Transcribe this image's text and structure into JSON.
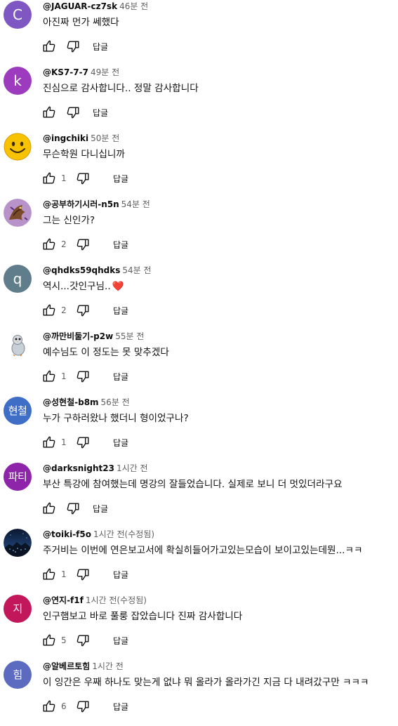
{
  "comments": [
    {
      "author": "@JAGUAR-cz7sk",
      "time": "46분 전",
      "text": "아진짜 먼가 쎄했다",
      "likes": "",
      "reply": "답글",
      "avatar": {
        "type": "letter",
        "letter": "C",
        "color": "#7e57c2"
      }
    },
    {
      "author": "@KS7-7-7",
      "time": "49분 전",
      "text": "진심으로 감사합니다.. 정말 감사합니다",
      "likes": "",
      "reply": "답글",
      "avatar": {
        "type": "letter",
        "letter": "k",
        "color": "#9c3bbd"
      }
    },
    {
      "author": "@ingchiki",
      "time": "50분 전",
      "text": "무슨학원 다니십니까",
      "likes": "1",
      "reply": "답글",
      "avatar": {
        "type": "icon",
        "icon": "smiley-face-icon"
      }
    },
    {
      "author": "@공부하기시러-n5n",
      "time": "54분 전",
      "text": "그는 신인가?",
      "likes": "2",
      "reply": "답글",
      "avatar": {
        "type": "icon",
        "icon": "dragon-illustration-icon"
      }
    },
    {
      "author": "@qhdks59qhdks",
      "time": "54분 전",
      "text": "역시...갓인구님..",
      "likes": "2",
      "reply": "답글",
      "heart": "❤️",
      "avatar": {
        "type": "letter",
        "letter": "q",
        "color": "#607d8b"
      }
    },
    {
      "author": "@까만비둘기-p2w",
      "time": "55분 전",
      "text": "예수님도 이 정도는 못 맞추겠다",
      "likes": "1",
      "reply": "답글",
      "avatar": {
        "type": "icon",
        "icon": "pigeon-icon"
      }
    },
    {
      "author": "@성현철-b8m",
      "time": "56분 전",
      "text": "누가 구하러왔나 했더니 형이었구나?",
      "likes": "1",
      "reply": "답글",
      "avatar": {
        "type": "letter",
        "letter": "현철",
        "color": "#3f6ec7"
      }
    },
    {
      "author": "@darksnight23",
      "time": "1시간 전",
      "text": "부산 특강에 참여했는데 명강의 잘들었습니다. 실제로 보니 더 멋있더라구요",
      "likes": "",
      "reply": "답글",
      "avatar": {
        "type": "letter",
        "letter": "파티",
        "color": "#8e24aa"
      }
    },
    {
      "author": "@toiki-f5o",
      "time": "1시간 전(수정됨)",
      "text": "주거비는 이번에 연은보고서에 확실히들어가고있는모습이 보이고있는데뭔...ㅋㅋ",
      "likes": "1",
      "reply": "답글",
      "avatar": {
        "type": "icon",
        "icon": "night-city-photo-icon"
      }
    },
    {
      "author": "@연지-f1f",
      "time": "1시간 전(수정됨)",
      "text": "인구햄보고 바로 풀룽 잡았습니다 진짜 감사합니다",
      "likes": "5",
      "reply": "답글",
      "avatar": {
        "type": "letter",
        "letter": "지",
        "color": "#c2185b"
      }
    },
    {
      "author": "@알베르토힘",
      "time": "1시간 전",
      "text": "이 잉간은 우째 하나도 맞는게 없냐 뭐 올라가 올라가긴 지금 다 내려갔구만 ㅋㅋㅋ",
      "likes": "6",
      "reply": "답글",
      "avatar": {
        "type": "letter",
        "letter": "힘",
        "color": "#5c6bc0"
      }
    }
  ]
}
